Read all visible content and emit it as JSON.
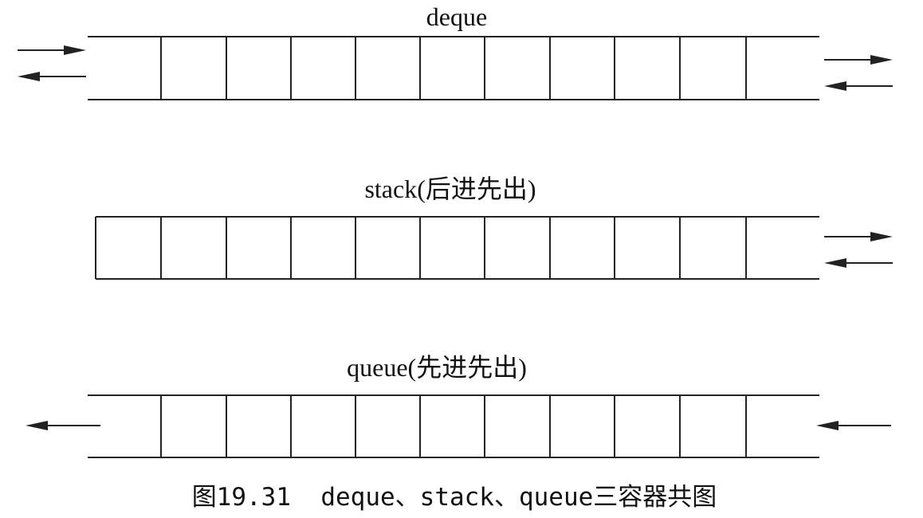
{
  "diagram": {
    "rows": [
      {
        "id": "deque",
        "title": "deque",
        "cells": 11,
        "left_end": "open",
        "right_end": "open",
        "left_arrows": [
          "in",
          "out"
        ],
        "right_arrows": [
          "out",
          "in"
        ]
      },
      {
        "id": "stack",
        "title": "stack(后进先出)",
        "cells": 11,
        "left_end": "closed",
        "right_end": "open",
        "left_arrows": [],
        "right_arrows": [
          "out",
          "in"
        ]
      },
      {
        "id": "queue",
        "title": "queue(先进先出)",
        "cells": 11,
        "left_end": "open",
        "right_end": "open",
        "left_arrows": [
          "out"
        ],
        "right_arrows": [
          "in"
        ]
      }
    ],
    "caption": "图19.31  deque、stack、queue三容器共图"
  },
  "colors": {
    "line": "#222222",
    "text": "#111111",
    "background": "#ffffff"
  }
}
